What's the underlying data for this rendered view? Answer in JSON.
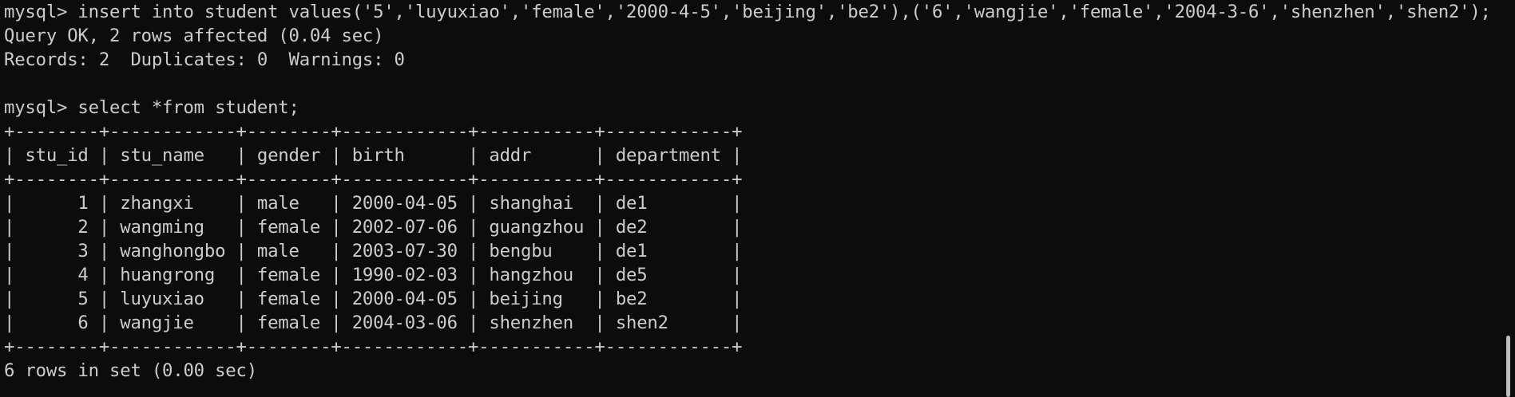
{
  "terminal": {
    "lines": [
      "mysql> insert into student values('5','luyuxiao','female','2000-4-5','beijing','be2'),('6','wangjie','female','2004-3-6','shenzhen','shen2');",
      "Query OK, 2 rows affected (0.04 sec)",
      "Records: 2  Duplicates: 0  Warnings: 0",
      "",
      "mysql> select *from student;",
      "+--------+------------+--------+------------+-----------+------------+",
      "| stu_id | stu_name   | gender | birth      | addr      | department |",
      "+--------+------------+--------+------------+-----------+------------+",
      "|      1 | zhangxi    | male   | 2000-04-05 | shanghai  | de1        |",
      "|      2 | wangming   | female | 2002-07-06 | guangzhou | de2        |",
      "|      3 | wanghongbo | male   | 2003-07-30 | bengbu    | de1        |",
      "|      4 | huangrong  | female | 1990-02-03 | hangzhou  | de5        |",
      "|      5 | luyuxiao   | female | 2000-04-05 | beijing   | be2        |",
      "|      6 | wangjie    | female | 2004-03-06 | shenzhen  | shen2      |",
      "+--------+------------+--------+------------+-----------+------------+",
      "6 rows in set (0.00 sec)"
    ]
  },
  "colors": {
    "background": "#0c0c0c",
    "foreground": "#cccccc",
    "scrollbar_thumb": "#bdbdbd"
  }
}
